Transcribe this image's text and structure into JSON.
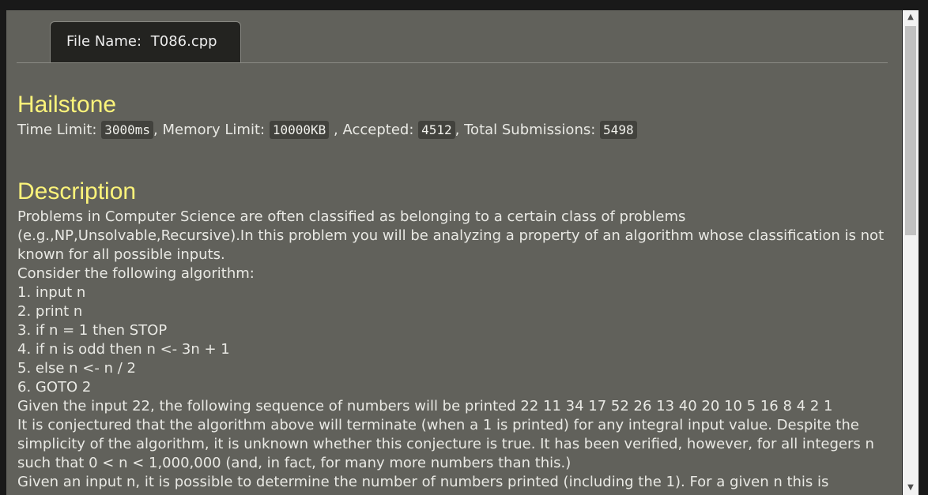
{
  "tab": {
    "label": "File Name",
    "separator": ":",
    "filename": "T086.cpp"
  },
  "problem": {
    "title": "Hailstone",
    "limits": {
      "time_label": "Time Limit:",
      "time_value": "3000ms",
      "time_sep": ",",
      "memory_label": "Memory Limit:",
      "memory_value": "10000KB",
      "memory_sep": ",",
      "accepted_label": "Accepted:",
      "accepted_value": "4512",
      "accepted_sep": ",",
      "total_label": "Total Submissions:",
      "total_value": "5498"
    },
    "description_title": "Description",
    "description": [
      "Problems in Computer Science are often classified as belonging to a certain class of problems (e.g.,NP,Unsolvable,Recursive).In this problem you will be analyzing a property of an algorithm whose classification is not known for all possible inputs.",
      "Consider the following algorithm:",
      "1. input n",
      "2. print n",
      "3. if n = 1 then STOP",
      "4. if n is odd then n <- 3n + 1",
      "5. else n <- n / 2",
      "6. GOTO 2",
      "Given the input 22, the following sequence of numbers will be printed 22 11 34 17 52 26 13 40 20 10 5 16 8 4 2 1",
      "It is conjectured that the algorithm above will terminate (when a 1 is printed) for any integral input value. Despite the simplicity of the algorithm, it is unknown whether this conjecture is true. It has been verified, however, for all integers n such that 0 < n < 1,000,000 (and, in fact, for many more numbers than this.)",
      "Given an input n, it is possible to determine the number of numbers printed (including the 1). For a given n this is"
    ]
  },
  "scrollbar": {
    "up_icon": "triangle-up",
    "down_icon": "triangle-down"
  }
}
